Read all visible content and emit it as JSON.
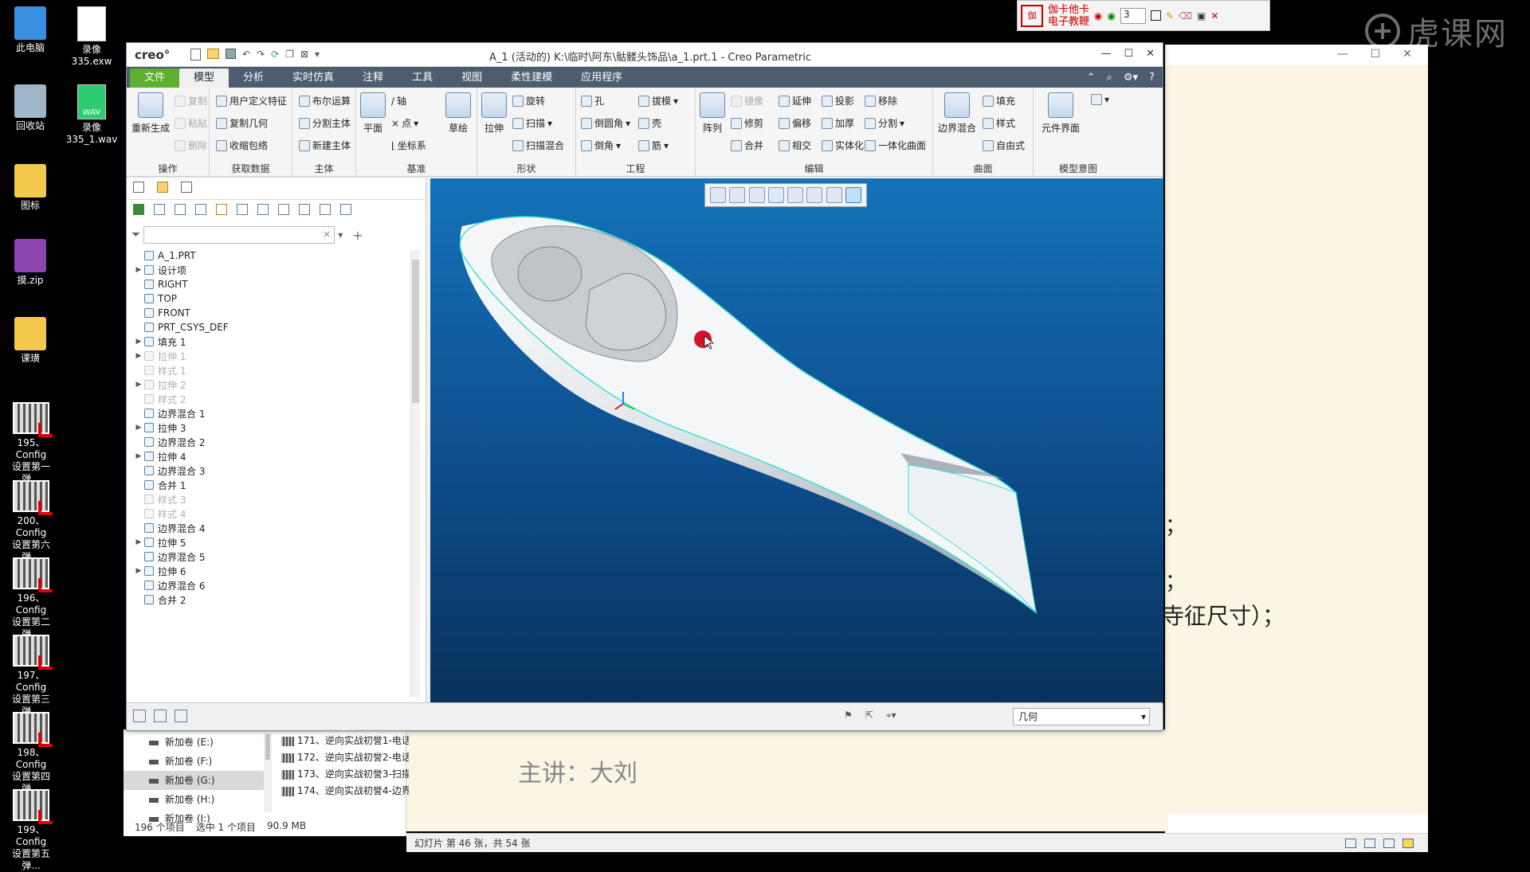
{
  "desktop": {
    "icons_col1": [
      {
        "label": "此电脑",
        "icon": "computer-icon"
      },
      {
        "label": "回收站",
        "icon": "recycle-bin-icon"
      },
      {
        "label": "图标",
        "icon": "folder-icon"
      },
      {
        "label": "摸.zip",
        "icon": "zip-archive-icon"
      },
      {
        "label": "课璜",
        "icon": "folder-icon"
      }
    ],
    "icons_col2": [
      {
        "label": "录像335.exw",
        "icon": "file-icon"
      },
      {
        "label": "录像\n335_1.wav",
        "icon": "wav-file-icon",
        "badge": "WAV"
      }
    ],
    "config_items": [
      {
        "line1": "195、Config",
        "line2": "设置第一弹..."
      },
      {
        "line1": "200、Config",
        "line2": "设置第六弹..."
      },
      {
        "line1": "196、Config",
        "line2": "设置第二弹..."
      },
      {
        "line1": "197、Config",
        "line2": "设置第三弹..."
      },
      {
        "line1": "198、Config",
        "line2": "设置第四弹..."
      },
      {
        "line1": "199、Config",
        "line2": "设置第五弹..."
      }
    ]
  },
  "jiaka_toolbar": {
    "title_line1": "伽卡他卡",
    "title_line2": "电子教鞭",
    "spin_value": "3"
  },
  "watermark": "虎课网",
  "ppt": {
    "lecturer": "主讲：大刘",
    "fragment1": "；",
    "fragment2": "；",
    "fragment3": "寺征尺寸）；",
    "status": "幻灯片 第 46 张，共 54 张"
  },
  "explorer": {
    "drives": [
      "新加卷 (E:)",
      "新加卷 (F:)",
      "新加卷 (G:)",
      "新加卷 (H:)",
      "新加卷 (I:)"
    ],
    "files": [
      "171、逆向实战初誉1-电话",
      "172、逆向实战初誉2-电话",
      "173、逆向实战初誉3-扫描",
      "174、逆向实战初誉4-边界"
    ],
    "status_count": "196 个项目",
    "status_selected": "选中 1 个项目",
    "status_size": "90.9 MB"
  },
  "creo": {
    "logo": "creo°",
    "title": "A_1 (活动的) K:\\临时\\阿东\\骷髅头饰品\\a_1.prt.1 - Creo Parametric",
    "menu": [
      "文件",
      "模型",
      "分析",
      "实时仿真",
      "注释",
      "工具",
      "视图",
      "柔性建模",
      "应用程序"
    ],
    "ribbon": {
      "ops": {
        "regen": "重新生成",
        "copy": "复制",
        "paste": "粘贴",
        "delete": "删除",
        "label": "操作"
      },
      "getdata": {
        "udf": "用户定义特征",
        "copygeom": "复制几何",
        "shrink": "收缩包络",
        "label": "获取数据"
      },
      "body": {
        "boolean": "布尔运算",
        "split": "分割主体",
        "newbody": "新建主体",
        "label": "主体"
      },
      "datum": {
        "plane": "平面",
        "axis": "轴",
        "point": "点",
        "csys": "坐标系",
        "sketch": "草绘",
        "label": "基准"
      },
      "shape": {
        "extrude": "拉伸",
        "revolve": "旋转",
        "sweep": "扫描",
        "sweepblend": "扫描混合",
        "label": "形状"
      },
      "eng": {
        "hole": "孔",
        "round": "倒圆角",
        "chamfer": "倒角",
        "draft": "拔模",
        "shell": "壳",
        "rib": "筋",
        "label": "工程"
      },
      "edit": {
        "pattern": "阵列",
        "mirror": "镜像",
        "trim": "修剪",
        "merge": "合并",
        "extend": "延伸",
        "offset": "偏移",
        "intersect": "相交",
        "project": "投影",
        "thicken": "加厚",
        "solidify": "实体化",
        "remove": "移除",
        "splitsurf": "分割",
        "unify": "一体化曲面",
        "label": "编辑"
      },
      "surface": {
        "boundary": "边界混合",
        "fill": "填充",
        "style": "样式",
        "freestyle": "自由式",
        "label": "曲面"
      },
      "intent": {
        "component": "元件界面",
        "label": "模型意图"
      }
    },
    "tree": [
      {
        "label": "A_1.PRT",
        "arrow": "",
        "dim": false,
        "indent": 0
      },
      {
        "label": "设计项",
        "arrow": "▶",
        "dim": false,
        "indent": 1
      },
      {
        "label": "RIGHT",
        "arrow": "",
        "dim": false,
        "indent": 1
      },
      {
        "label": "TOP",
        "arrow": "",
        "dim": false,
        "indent": 1
      },
      {
        "label": "FRONT",
        "arrow": "",
        "dim": false,
        "indent": 1
      },
      {
        "label": "PRT_CSYS_DEF",
        "arrow": "",
        "dim": false,
        "indent": 1
      },
      {
        "label": "填充 1",
        "arrow": "▶",
        "dim": false,
        "indent": 1
      },
      {
        "label": "拉伸 1",
        "arrow": "▶",
        "dim": true,
        "indent": 1
      },
      {
        "label": "样式 1",
        "arrow": "",
        "dim": true,
        "indent": 1
      },
      {
        "label": "拉伸 2",
        "arrow": "▶",
        "dim": true,
        "indent": 1
      },
      {
        "label": "样式 2",
        "arrow": "",
        "dim": true,
        "indent": 1
      },
      {
        "label": "边界混合 1",
        "arrow": "",
        "dim": false,
        "indent": 1
      },
      {
        "label": "拉伸 3",
        "arrow": "▶",
        "dim": false,
        "indent": 1
      },
      {
        "label": "边界混合 2",
        "arrow": "",
        "dim": false,
        "indent": 1
      },
      {
        "label": "拉伸 4",
        "arrow": "▶",
        "dim": false,
        "indent": 1
      },
      {
        "label": "边界混合 3",
        "arrow": "",
        "dim": false,
        "indent": 1
      },
      {
        "label": "合并 1",
        "arrow": "",
        "dim": false,
        "indent": 1
      },
      {
        "label": "样式 3",
        "arrow": "",
        "dim": true,
        "indent": 1
      },
      {
        "label": "样式 4",
        "arrow": "",
        "dim": true,
        "indent": 1
      },
      {
        "label": "边界混合 4",
        "arrow": "",
        "dim": false,
        "indent": 1
      },
      {
        "label": "拉伸 5",
        "arrow": "▶",
        "dim": false,
        "indent": 1
      },
      {
        "label": "边界混合 5",
        "arrow": "",
        "dim": false,
        "indent": 1
      },
      {
        "label": "拉伸 6",
        "arrow": "▶",
        "dim": false,
        "indent": 1
      },
      {
        "label": "边界混合 6",
        "arrow": "",
        "dim": false,
        "indent": 1
      },
      {
        "label": "合并 2",
        "arrow": "",
        "dim": false,
        "indent": 1
      }
    ],
    "filter_select": "几何",
    "colors": {
      "menubar": "#4d5c6f",
      "file_tab": "#5caf2f",
      "viewport_top": "#1472b9",
      "viewport_bottom": "#09315c",
      "highlight_edge": "#3fe0d0",
      "cursor_dot": "#d0142a"
    }
  }
}
